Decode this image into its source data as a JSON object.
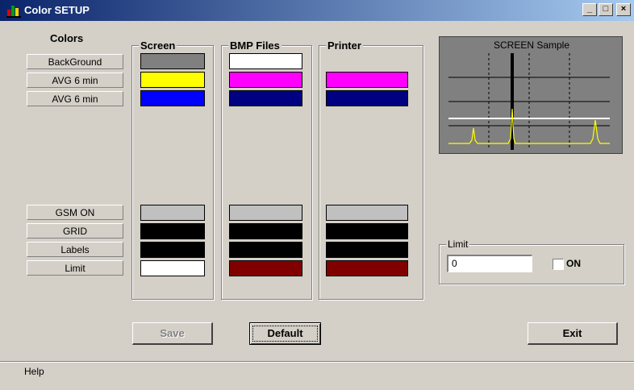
{
  "window": {
    "title": "Color SETUP",
    "min": "_",
    "max": "□",
    "close": "×"
  },
  "colors": {
    "heading": "Colors",
    "rows": [
      {
        "label": "BackGround",
        "screen": "#808080",
        "bmp": "#ffffff",
        "printer": ""
      },
      {
        "label": "AVG  6 min",
        "screen": "#ffff00",
        "bmp": "#ff00ff",
        "printer": "#ff00ff"
      },
      {
        "label": "AVG  6 min",
        "screen": "#0000ff",
        "bmp": "#000080",
        "printer": "#000080"
      },
      {
        "label": "GSM ON",
        "screen": "#c0c0c0",
        "bmp": "#c0c0c0",
        "printer": "#c0c0c0"
      },
      {
        "label": "GRID",
        "screen": "#000000",
        "bmp": "#000000",
        "printer": "#000000"
      },
      {
        "label": "Labels",
        "screen": "#000000",
        "bmp": "#000000",
        "printer": "#000000"
      },
      {
        "label": "Limit",
        "screen": "#ffffff",
        "bmp": "#800000",
        "printer": "#800000"
      }
    ]
  },
  "groups": {
    "screen": "Screen",
    "bmp": "BMP Files",
    "printer": "Printer"
  },
  "sample": {
    "title": "SCREEN Sample"
  },
  "limit": {
    "title": "Limit",
    "value": "0",
    "checkbox_label": "ON",
    "checked": false
  },
  "buttons": {
    "save": "Save",
    "default": "Default",
    "exit": "Exit"
  },
  "status": {
    "text": "Help"
  }
}
